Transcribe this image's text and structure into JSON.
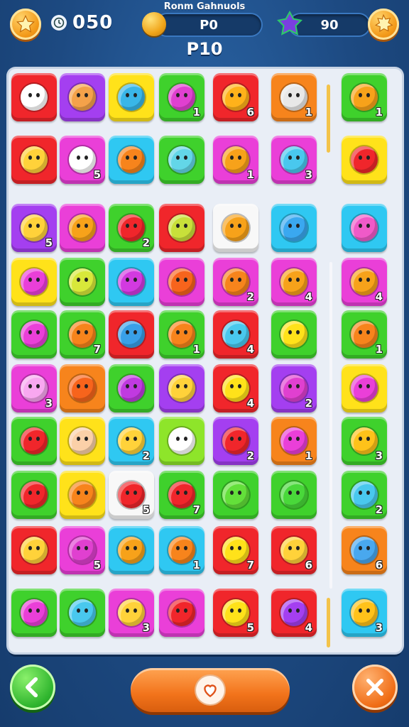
{
  "header": {
    "subtitle": "Ronm Gahnuols",
    "coin_count": "050",
    "center_pill_value": "P0",
    "right_pill_value": "90",
    "level_label": "P10",
    "icons": {
      "left_button": "star-icon",
      "clock": "clock-icon",
      "center_pill": "coin-icon",
      "right_pill": "gem-icon",
      "right_button": "starburst-icon"
    }
  },
  "colors": {
    "red": "#f0262b",
    "orange": "#f7841c",
    "yellow": "#ffe21a",
    "green": "#3fd12c",
    "lime": "#8ee52a",
    "purple": "#a43ff0",
    "magenta": "#ea3fd8",
    "cyan": "#2fc8f2",
    "white": "#f8f8f8",
    "board": "#e9eef6",
    "background": "#1f4f8a"
  },
  "board": {
    "rows": [
      [
        {
          "c": "red",
          "i": "#ffffff",
          "n": ""
        },
        {
          "c": "purple",
          "i": "#f4a24a",
          "n": ""
        },
        {
          "c": "yellow",
          "i": "#39b6e8",
          "n": ""
        },
        {
          "c": "green",
          "i": "#e040d0",
          "n": "1"
        },
        {
          "c": "red",
          "i": "#ffb21a",
          "n": "6"
        },
        {
          "c": "orange",
          "i": "#e8e8e8",
          "n": "1"
        },
        {
          "c": "green",
          "i": "#f7a21a",
          "n": "1"
        }
      ],
      [
        {
          "c": "red",
          "i": "#ffd23a",
          "n": ""
        },
        {
          "c": "magenta",
          "i": "#ffffff",
          "n": "5"
        },
        {
          "c": "cyan",
          "i": "#f7841c",
          "n": ""
        },
        {
          "c": "green",
          "i": "#63d6e8",
          "n": ""
        },
        {
          "c": "magenta",
          "i": "#f7a21a",
          "n": "1"
        },
        {
          "c": "magenta",
          "i": "#49c8ee",
          "n": "3"
        },
        {
          "c": "yellow",
          "i": "#f0262b",
          "n": ""
        }
      ],
      [
        {
          "c": "purple",
          "i": "#ffd23a",
          "n": "5"
        },
        {
          "c": "magenta",
          "i": "#f7a21a",
          "n": ""
        },
        {
          "c": "green",
          "i": "#f0262b",
          "n": "2"
        },
        {
          "c": "red",
          "i": "#c8e03a",
          "n": ""
        },
        {
          "c": "white",
          "i": "#f7a21a",
          "n": ""
        },
        {
          "c": "cyan",
          "i": "#3aa8f0",
          "n": ""
        },
        {
          "c": "cyan",
          "i": "#f05ac8",
          "n": ""
        }
      ],
      [
        {
          "c": "yellow",
          "i": "#ea3fd8",
          "n": ""
        },
        {
          "c": "green",
          "i": "#d8e83a",
          "n": ""
        },
        {
          "c": "cyan",
          "i": "#d23ae0",
          "n": ""
        },
        {
          "c": "magenta",
          "i": "#f7641c",
          "n": ""
        },
        {
          "c": "magenta",
          "i": "#f7841c",
          "n": "2"
        },
        {
          "c": "magenta",
          "i": "#f7a21a",
          "n": "4"
        },
        {
          "c": "magenta",
          "i": "#f7a21a",
          "n": "4"
        }
      ],
      [
        {
          "c": "green",
          "i": "#ea3fd8",
          "n": ""
        },
        {
          "c": "green",
          "i": "#f7841c",
          "n": "7"
        },
        {
          "c": "red",
          "i": "#39a0e8",
          "n": ""
        },
        {
          "c": "green",
          "i": "#f7841c",
          "n": "1"
        },
        {
          "c": "red",
          "i": "#49c8ee",
          "n": "4"
        },
        {
          "c": "green",
          "i": "#ffe21a",
          "n": ""
        },
        {
          "c": "green",
          "i": "#f7841c",
          "n": "1"
        }
      ],
      [
        {
          "c": "magenta",
          "i": "#f8a8f0",
          "n": "3"
        },
        {
          "c": "orange",
          "i": "#f7641c",
          "n": ""
        },
        {
          "c": "green",
          "i": "#c03ae0",
          "n": ""
        },
        {
          "c": "purple",
          "i": "#ffd23a",
          "n": ""
        },
        {
          "c": "red",
          "i": "#ffe21a",
          "n": "4"
        },
        {
          "c": "purple",
          "i": "#e040d0",
          "n": "2"
        },
        {
          "c": "yellow",
          "i": "#ea3fd8",
          "n": ""
        }
      ],
      [
        {
          "c": "green",
          "i": "#f0262b",
          "n": ""
        },
        {
          "c": "yellow",
          "i": "#fbd0a8",
          "n": ""
        },
        {
          "c": "cyan",
          "i": "#ffd23a",
          "n": "2"
        },
        {
          "c": "lime",
          "i": "#ffffff",
          "n": ""
        },
        {
          "c": "purple",
          "i": "#f0262b",
          "n": "2"
        },
        {
          "c": "orange",
          "i": "#ea3fd8",
          "n": "1"
        },
        {
          "c": "green",
          "i": "#ffc21a",
          "n": "3"
        }
      ],
      [
        {
          "c": "green",
          "i": "#f0262b",
          "n": ""
        },
        {
          "c": "yellow",
          "i": "#f7841c",
          "n": ""
        },
        {
          "c": "white",
          "i": "#f0262b",
          "n": "5"
        },
        {
          "c": "green",
          "i": "#f0262b",
          "n": "7"
        },
        {
          "c": "green",
          "i": "#63e03a",
          "n": ""
        },
        {
          "c": "green",
          "i": "#49d83a",
          "n": ""
        },
        {
          "c": "green",
          "i": "#49c8ee",
          "n": "2"
        }
      ],
      [
        {
          "c": "red",
          "i": "#ffd23a",
          "n": ""
        },
        {
          "c": "magenta",
          "i": "#e040d0",
          "n": "5"
        },
        {
          "c": "cyan",
          "i": "#f7a21a",
          "n": ""
        },
        {
          "c": "cyan",
          "i": "#f7841c",
          "n": "1"
        },
        {
          "c": "red",
          "i": "#ffe21a",
          "n": "7"
        },
        {
          "c": "red",
          "i": "#ffd23a",
          "n": "6"
        },
        {
          "c": "orange",
          "i": "#49a8ee",
          "n": "6"
        }
      ],
      [
        {
          "c": "green",
          "i": "#ea3fd8",
          "n": ""
        },
        {
          "c": "green",
          "i": "#49c8ee",
          "n": ""
        },
        {
          "c": "magenta",
          "i": "#ffd23a",
          "n": "3"
        },
        {
          "c": "magenta",
          "i": "#f0262b",
          "n": ""
        },
        {
          "c": "red",
          "i": "#ffe21a",
          "n": "5"
        },
        {
          "c": "red",
          "i": "#a43ff0",
          "n": "4"
        },
        {
          "c": "cyan",
          "i": "#ffc21a",
          "n": "3"
        }
      ]
    ]
  },
  "footer": {
    "back_icon": "chevron-left-icon",
    "main_icon": "heart-icon",
    "next_icon": "close-icon"
  }
}
